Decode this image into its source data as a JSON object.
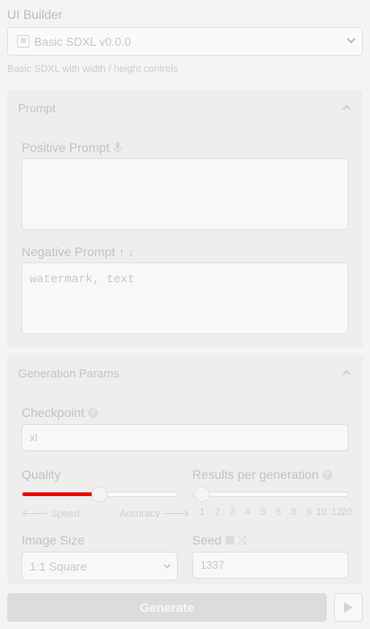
{
  "builder": {
    "label": "UI Builder",
    "selected": "Basic SDXL v0.0.0",
    "icon": "image-icon",
    "description": "Basic SDXL with width / height controls"
  },
  "prompt_panel": {
    "title": "Prompt",
    "positive_label": "Positive Prompt",
    "positive_value": "",
    "negative_label": "Negative Prompt",
    "negative_placeholder": "watermark, text"
  },
  "gen_panel": {
    "title": "Generation Params",
    "checkpoint_label": "Checkpoint",
    "checkpoint_value": "xl",
    "quality_label": "Quality",
    "quality_level": 0.5,
    "quality_left": "Speed",
    "quality_right": "Accuracy",
    "results_label": "Results per generation",
    "results_value": 1,
    "results_ticks": [
      "1",
      "2",
      "3",
      "4",
      "5",
      "6",
      "8",
      "9",
      "10",
      "12",
      "20"
    ],
    "image_size_label": "Image Size",
    "image_size_value": "1:1 Square",
    "seed_label": "Seed",
    "seed_value": "1337"
  },
  "footer": {
    "generate_label": "Generate"
  },
  "colors": {
    "accent": "#ee0000",
    "background": "#f4f4f4"
  }
}
